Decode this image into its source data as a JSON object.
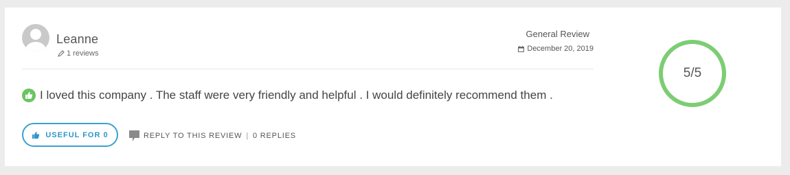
{
  "reviewer": {
    "name": "Leanne",
    "reviews_count": "1 reviews"
  },
  "review": {
    "type": "General Review",
    "date": "December 20, 2019",
    "text": "I loved this company . The staff were very friendly and helpful . I would definitely recommend them .",
    "sentiment_icon": "thumbs-up-icon",
    "sentiment_color": "#6cc463"
  },
  "actions": {
    "useful_label": "USEFUL FOR 0",
    "reply_label": "REPLY TO THIS REVIEW",
    "separator": "|",
    "replies_label": "0 REPLIES"
  },
  "rating": {
    "text": "5/5",
    "value": 5,
    "max": 5,
    "ring_color": "#7ccd73"
  },
  "colors": {
    "accent_blue": "#3aa0cf",
    "avatar_gray": "#c9c9c9"
  }
}
